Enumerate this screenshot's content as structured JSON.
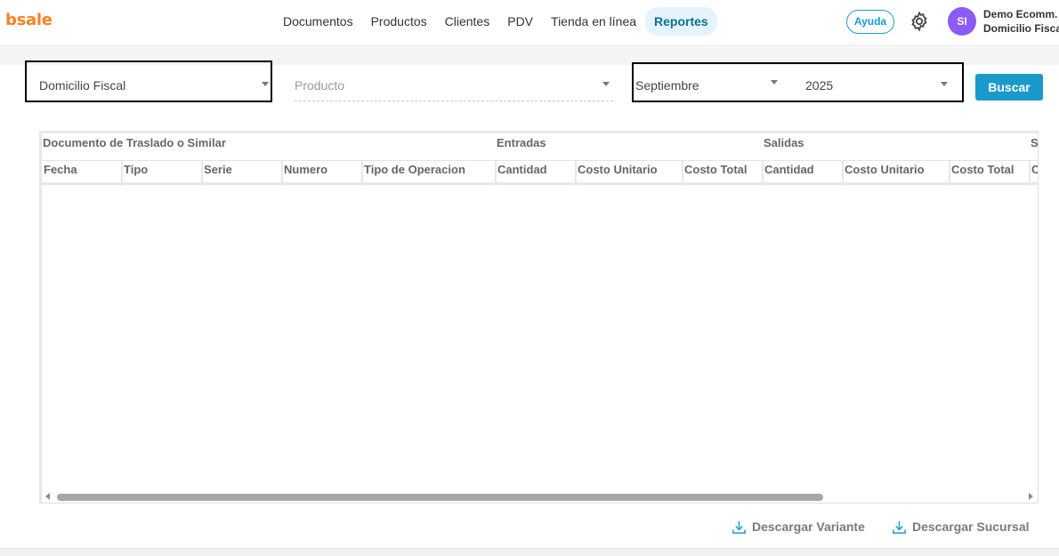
{
  "app": {
    "logo": "bsale"
  },
  "nav": {
    "items": [
      {
        "label": "Documentos"
      },
      {
        "label": "Productos"
      },
      {
        "label": "Clientes"
      },
      {
        "label": "PDV"
      },
      {
        "label": "Tienda en línea"
      },
      {
        "label": "Reportes"
      }
    ],
    "active": "Reportes"
  },
  "header": {
    "help_label": "Ayuda",
    "avatar_initials": "SI",
    "avatar_color": "#8b5cf6",
    "user_name": "Demo Ecomm.",
    "user_branch": "Domicilio Fiscal"
  },
  "filters": {
    "branch": {
      "value": "Domicilio Fiscal"
    },
    "product": {
      "placeholder": "Producto"
    },
    "month": {
      "value": "Septiembre"
    },
    "year": {
      "value": "2025"
    },
    "search_label": "Buscar"
  },
  "table": {
    "groups": [
      {
        "label": "Documento de Traslado o Similar"
      },
      {
        "label": "Entradas"
      },
      {
        "label": "Salidas"
      },
      {
        "label": "S"
      }
    ],
    "columns": [
      {
        "label": "Fecha"
      },
      {
        "label": "Tipo"
      },
      {
        "label": "Serie"
      },
      {
        "label": "Numero"
      },
      {
        "label": "Tipo de Operacion"
      },
      {
        "label": "Cantidad"
      },
      {
        "label": "Costo Unitario"
      },
      {
        "label": "Costo Total"
      },
      {
        "label": "Cantidad"
      },
      {
        "label": "Costo Unitario"
      },
      {
        "label": "Costo Total"
      },
      {
        "label": "C"
      }
    ],
    "rows": []
  },
  "downloads": {
    "variant_label": "Descargar Variante",
    "branch_label": "Descargar Sucursal"
  },
  "colors": {
    "accent": "#1a9acb",
    "brand": "#f5821f",
    "active_nav_bg": "#e5f4fa"
  }
}
